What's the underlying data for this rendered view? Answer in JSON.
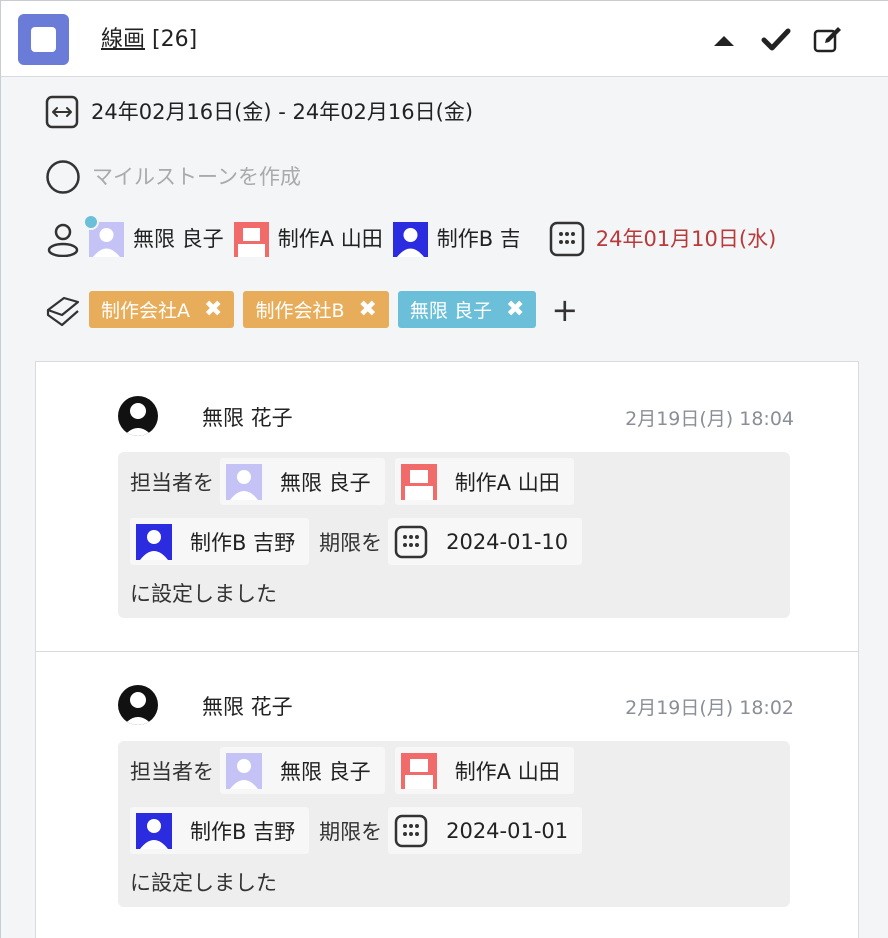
{
  "header": {
    "title": "線画",
    "count": "[26]"
  },
  "task": {
    "date_range": "24年02月16日(金) - 24年02月16日(金)",
    "milestone_placeholder": "マイルストーンを作成",
    "assignees": [
      {
        "name": "無限 良子",
        "color": "#c5c3f5"
      },
      {
        "name": "制作A 山田",
        "color": "#f26b6b"
      },
      {
        "name": "制作B 吉",
        "color": "#2b2be0"
      }
    ],
    "due_date": "24年01月10日(水)",
    "tags": [
      {
        "label": "制作会社A",
        "color": "#e8ad5a"
      },
      {
        "label": "制作会社B",
        "color": "#e8ad5a"
      },
      {
        "label": "無限 良子",
        "color": "#6cbfd8"
      }
    ],
    "remove_symbol": "✖",
    "add_symbol": "+"
  },
  "activity": [
    {
      "user": "無限 花子",
      "timestamp": "2月19日(月) 18:04",
      "assignee_prefix": "担当者を",
      "assignees": [
        "無限 良子",
        "制作A 山田",
        "制作B 吉野"
      ],
      "due_prefix": "期限を",
      "due_value": "2024-01-10",
      "suffix": "に設定しました"
    },
    {
      "user": "無限 花子",
      "timestamp": "2月19日(月) 18:02",
      "assignee_prefix": "担当者を",
      "assignees": [
        "無限 良子",
        "制作A 山田",
        "制作B 吉野"
      ],
      "due_prefix": "期限を",
      "due_value": "2024-01-01",
      "suffix": "に設定しました"
    }
  ],
  "colors": {
    "accent": "#6a7bd8",
    "due_red": "#b83a3a",
    "online_dot": "#6cbfd8"
  }
}
